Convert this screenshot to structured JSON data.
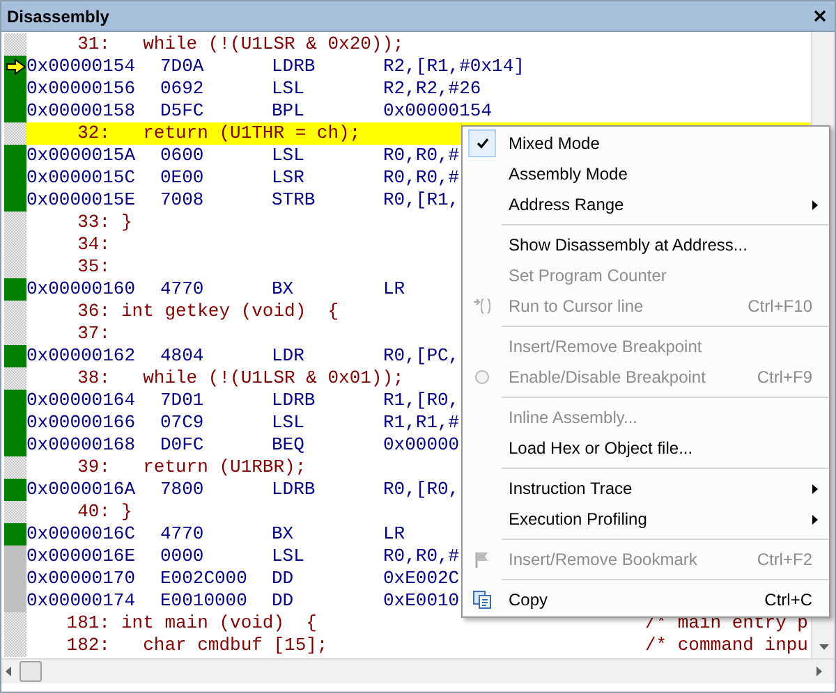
{
  "window": {
    "title": "Disassembly"
  },
  "lines": [
    {
      "kind": "source",
      "number": "31:",
      "text": "  while (!(U1LSR & 0x20));"
    },
    {
      "kind": "asm",
      "color": "#008000",
      "current": true,
      "address": "0x00000154",
      "opcode": "7D0A",
      "mnemonic": "LDRB",
      "operand": "R2,[R1,#0x14]"
    },
    {
      "kind": "asm",
      "color": "#008000",
      "current": false,
      "address": "0x00000156",
      "opcode": "0692",
      "mnemonic": "LSL",
      "operand": "R2,R2,#26"
    },
    {
      "kind": "asm",
      "color": "#008000",
      "current": false,
      "address": "0x00000158",
      "opcode": "D5FC",
      "mnemonic": "BPL",
      "operand": "0x00000154"
    },
    {
      "kind": "source",
      "highlighted": true,
      "number": "32:",
      "text": "  return (U1THR = ch);"
    },
    {
      "kind": "asm",
      "color": "#008000",
      "current": false,
      "address": "0x0000015A",
      "opcode": "0600",
      "mnemonic": "LSL",
      "operand": "R0,R0,#"
    },
    {
      "kind": "asm",
      "color": "#008000",
      "current": false,
      "address": "0x0000015C",
      "opcode": "0E00",
      "mnemonic": "LSR",
      "operand": "R0,R0,#"
    },
    {
      "kind": "asm",
      "color": "#008000",
      "current": false,
      "address": "0x0000015E",
      "opcode": "7008",
      "mnemonic": "STRB",
      "operand": "R0,[R1,"
    },
    {
      "kind": "source",
      "number": "33:",
      "text": "}"
    },
    {
      "kind": "source",
      "number": "34:"
    },
    {
      "kind": "source",
      "number": "35:"
    },
    {
      "kind": "asm",
      "color": "#008000",
      "current": false,
      "address": "0x00000160",
      "opcode": "4770",
      "mnemonic": "BX",
      "operand": "LR"
    },
    {
      "kind": "source",
      "number": "36:",
      "text": "int getkey (void)  {"
    },
    {
      "kind": "source",
      "number": "37:"
    },
    {
      "kind": "asm",
      "color": "#008000",
      "current": false,
      "address": "0x00000162",
      "opcode": "4804",
      "mnemonic": "LDR",
      "operand": "R0,[PC,"
    },
    {
      "kind": "source",
      "number": "38:",
      "text": "  while (!(U1LSR & 0x01));"
    },
    {
      "kind": "asm",
      "color": "#008000",
      "current": false,
      "address": "0x00000164",
      "opcode": "7D01",
      "mnemonic": "LDRB",
      "operand": "R1,[R0,"
    },
    {
      "kind": "asm",
      "color": "#008000",
      "current": false,
      "address": "0x00000166",
      "opcode": "07C9",
      "mnemonic": "LSL",
      "operand": "R1,R1,#"
    },
    {
      "kind": "asm",
      "color": "#008000",
      "current": false,
      "address": "0x00000168",
      "opcode": "D0FC",
      "mnemonic": "BEQ",
      "operand": "0x00000"
    },
    {
      "kind": "source",
      "number": "39:",
      "text": "  return (U1RBR);"
    },
    {
      "kind": "asm",
      "color": "#008000",
      "current": false,
      "address": "0x0000016A",
      "opcode": "7800",
      "mnemonic": "LDRB",
      "operand": "R0,[R0,"
    },
    {
      "kind": "source",
      "number": "40:",
      "text": "}"
    },
    {
      "kind": "asm",
      "color": "#008000",
      "current": false,
      "address": "0x0000016C",
      "opcode": "4770",
      "mnemonic": "BX",
      "operand": "LR"
    },
    {
      "kind": "asm",
      "color": "#c0c0c0",
      "current": false,
      "address": "0x0000016E",
      "opcode": "0000",
      "mnemonic": "LSL",
      "operand": "R0,R0,#"
    },
    {
      "kind": "asm",
      "color": "#c0c0c0",
      "current": false,
      "address": "0x00000170",
      "opcode": "E002C000",
      "mnemonic": "DD",
      "operand": "0xE002C"
    },
    {
      "kind": "asm",
      "color": "#c0c0c0",
      "current": false,
      "address": "0x00000174",
      "opcode": "E0010000",
      "mnemonic": "DD",
      "operand": "0xE0010"
    },
    {
      "kind": "source",
      "number": "181:",
      "text": "int main (void)  {",
      "comment": "/* main entry p"
    },
    {
      "kind": "source",
      "number": "182:",
      "text": "  char cmdbuf [15];",
      "comment": "/* command inpu"
    }
  ],
  "context_menu": [
    {
      "kind": "item",
      "label": "Mixed Mode",
      "checked": true,
      "disabled": false
    },
    {
      "kind": "item",
      "label": "Assembly Mode",
      "checked": false,
      "disabled": false
    },
    {
      "kind": "item",
      "label": "Address Range",
      "checked": false,
      "disabled": false,
      "submenu": true
    },
    {
      "kind": "separator"
    },
    {
      "kind": "item",
      "label": "Show Disassembly at Address...",
      "checked": false,
      "disabled": false
    },
    {
      "kind": "item",
      "label": "Set Program Counter",
      "checked": false,
      "disabled": true
    },
    {
      "kind": "item",
      "label": "Run to Cursor line",
      "checked": false,
      "disabled": true,
      "shortcut": "Ctrl+F10"
    },
    {
      "kind": "separator"
    },
    {
      "kind": "item",
      "label": "Insert/Remove Breakpoint",
      "checked": false,
      "disabled": true
    },
    {
      "kind": "item",
      "label": "Enable/Disable Breakpoint",
      "checked": false,
      "disabled": true,
      "shortcut": "Ctrl+F9"
    },
    {
      "kind": "separator"
    },
    {
      "kind": "item",
      "label": "Inline Assembly...",
      "checked": false,
      "disabled": true
    },
    {
      "kind": "item",
      "label": "Load Hex or Object file...",
      "checked": false,
      "disabled": false
    },
    {
      "kind": "separator"
    },
    {
      "kind": "item",
      "label": "Instruction Trace",
      "checked": false,
      "disabled": false,
      "submenu": true
    },
    {
      "kind": "item",
      "label": "Execution Profiling",
      "checked": false,
      "disabled": false,
      "submenu": true
    },
    {
      "kind": "separator"
    },
    {
      "kind": "item",
      "label": "Insert/Remove Bookmark",
      "checked": false,
      "disabled": true,
      "shortcut": "Ctrl+F2"
    },
    {
      "kind": "separator"
    },
    {
      "kind": "item",
      "label": "Copy",
      "checked": false,
      "disabled": false,
      "shortcut": "Ctrl+C"
    }
  ]
}
